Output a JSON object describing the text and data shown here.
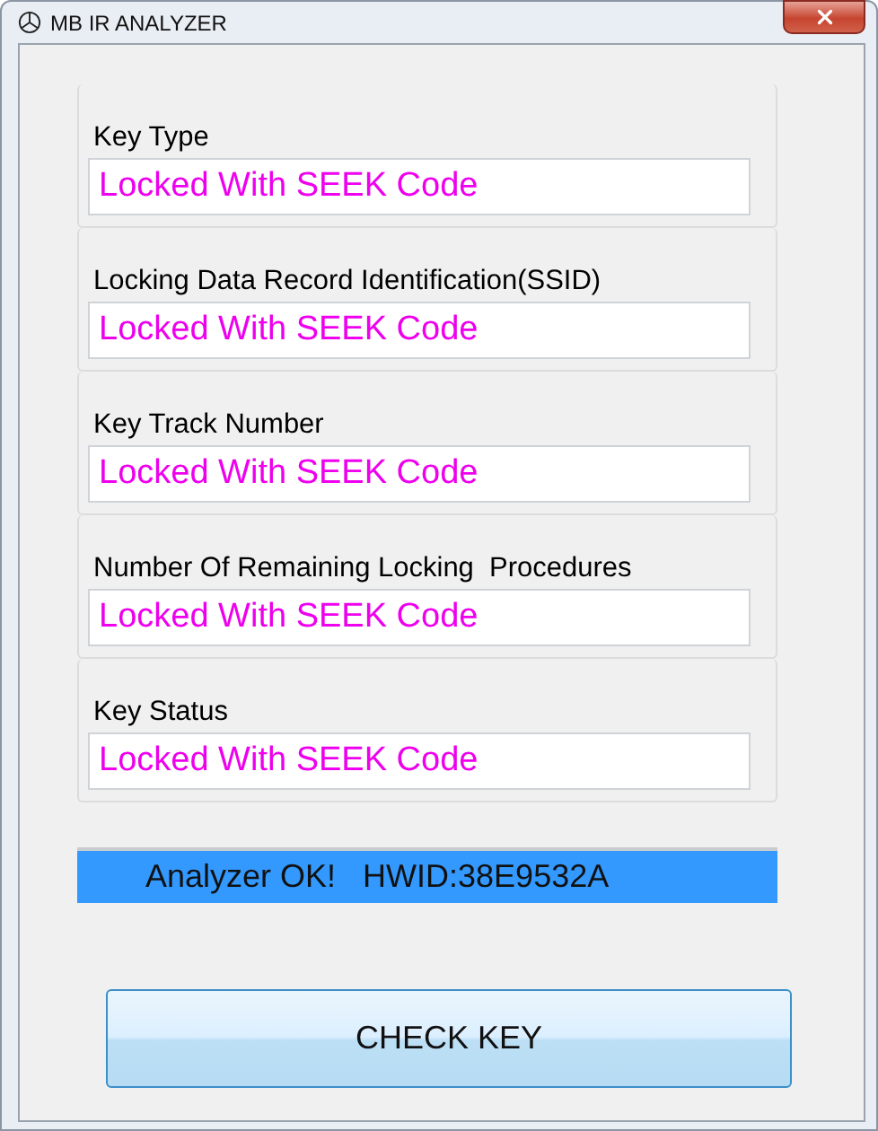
{
  "window": {
    "title": "MB IR ANALYZER"
  },
  "fields": [
    {
      "label": "Key Type",
      "value": "Locked With SEEK Code"
    },
    {
      "label": "Locking Data Record Identification(SSID)",
      "value": "Locked With SEEK Code"
    },
    {
      "label": "Key Track Number",
      "value": "Locked With SEEK Code"
    },
    {
      "label": "Number Of Remaining Locking  Procedures",
      "value": "Locked With SEEK Code"
    },
    {
      "label": "Key Status",
      "value": "Locked With SEEK Code"
    }
  ],
  "status": "Analyzer OK!   HWID:38E9532A",
  "button": "CHECK KEY"
}
